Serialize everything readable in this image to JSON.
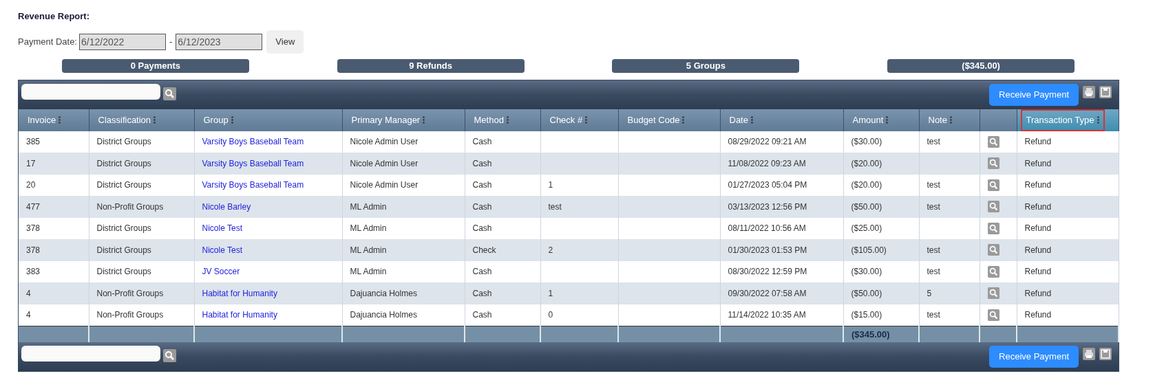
{
  "title": "Revenue Report:",
  "filter": {
    "label": "Payment Date:",
    "from": "6/12/2022",
    "separator": "-",
    "to": "6/12/2023",
    "button": "View"
  },
  "summary": [
    "0 Payments",
    "9 Refunds",
    "5 Groups",
    "($345.00)"
  ],
  "toolbars": [
    {
      "button": "Receive Payment"
    },
    {
      "button": "Receive Payment"
    }
  ],
  "table": {
    "columns": [
      {
        "label": "Invoice",
        "highlighted": false
      },
      {
        "label": "Classification",
        "highlighted": false
      },
      {
        "label": "Group",
        "highlighted": false
      },
      {
        "label": "Primary Manager",
        "highlighted": false
      },
      {
        "label": "Method",
        "highlighted": false
      },
      {
        "label": "Check #",
        "highlighted": false
      },
      {
        "label": "Budget Code",
        "highlighted": false
      },
      {
        "label": "Date",
        "highlighted": false
      },
      {
        "label": "Amount",
        "highlighted": false
      },
      {
        "label": "Note",
        "highlighted": false
      },
      {
        "highlighted": false
      },
      {
        "label": "Transaction Type",
        "highlighted": true
      }
    ],
    "rows": [
      [
        "385",
        "District Groups",
        "Varsity Boys Baseball Team",
        "Nicole Admin User",
        "Cash",
        "",
        "",
        "08/29/2022 09:21 AM",
        "($30.00)",
        "test",
        "Refund"
      ],
      [
        "17",
        "District Groups",
        "Varsity Boys Baseball Team",
        "Nicole Admin User",
        "Cash",
        "",
        "",
        "11/08/2022 09:23 AM",
        "($20.00)",
        "",
        "Refund"
      ],
      [
        "20",
        "District Groups",
        "Varsity Boys Baseball Team",
        "Nicole Admin User",
        "Cash",
        "1",
        "",
        "01/27/2023 05:04 PM",
        "($20.00)",
        "test",
        "Refund"
      ],
      [
        "477",
        "Non-Profit Groups",
        "Nicole Barley",
        "ML Admin",
        "Cash",
        "test",
        "",
        "03/13/2023 12:56 PM",
        "($50.00)",
        "test",
        "Refund"
      ],
      [
        "378",
        "District Groups",
        "Nicole Test",
        "ML Admin",
        "Cash",
        "",
        "",
        "08/11/2022 10:56 AM",
        "($25.00)",
        "",
        "Refund"
      ],
      [
        "378",
        "District Groups",
        "Nicole Test",
        "ML Admin",
        "Check",
        "2",
        "",
        "01/30/2023 01:53 PM",
        "($105.00)",
        "test",
        "Refund"
      ],
      [
        "383",
        "District Groups",
        "JV Soccer",
        "ML Admin",
        "Cash",
        "",
        "",
        "08/30/2022 12:59 PM",
        "($30.00)",
        "test",
        "Refund"
      ],
      [
        "4",
        "Non-Profit Groups",
        "Habitat for Humanity",
        "Dajuancia Holmes",
        "Cash",
        "1",
        "",
        "09/30/2022 07:58 AM",
        "($50.00)",
        "5",
        "Refund"
      ],
      [
        "4",
        "Non-Profit Groups",
        "Habitat for Humanity",
        "Dajuancia Holmes",
        "Cash",
        "0",
        "",
        "11/14/2022 10:35 AM",
        "($15.00)",
        "test",
        "Refund"
      ]
    ],
    "total": "($345.00)"
  }
}
